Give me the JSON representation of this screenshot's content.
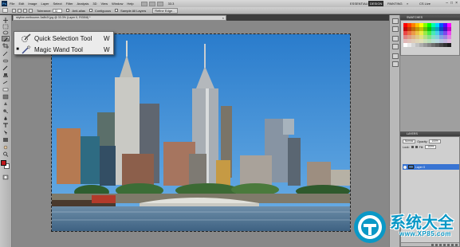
{
  "menubar": {
    "logo": "Ps",
    "items": [
      "File",
      "Edit",
      "Image",
      "Layer",
      "Select",
      "Filter",
      "Analysis",
      "3D",
      "View",
      "Window",
      "Help"
    ],
    "zoom": "33.3",
    "workspaces": {
      "essentials": "ESSENTIALS",
      "design": "DESIGN",
      "painting": "PAINTING",
      "more": "»",
      "cs_live": "CS Live"
    },
    "window_controls": [
      "–",
      "□",
      "×"
    ]
  },
  "options": {
    "tolerance_label": "Tolerance:",
    "tolerance_value": "32",
    "anti_alias_label": "Anti-alias",
    "contiguous_label": "Contiguous",
    "sample_all_label": "Sample All Layers",
    "refine_edge_label": "Refine Edge..."
  },
  "document": {
    "tab_title": "skyline-melbourne-3a8b2f.jpg @ 33.3% (Layer 0, RGB/8) *",
    "close_glyph": "×"
  },
  "flyout": {
    "items": [
      {
        "bullet": "",
        "label": "Quick Selection Tool",
        "shortcut": "W"
      },
      {
        "bullet": "■",
        "label": "Magic Wand Tool",
        "shortcut": "W"
      }
    ]
  },
  "panels": {
    "swatches_tab": "SWATCHES",
    "layers_tab": "LAYERS",
    "blend_mode": "Normal",
    "opacity_label": "Opacity:",
    "opacity_value": "100%",
    "lock_label": "Lock:",
    "fill_label": "Fill:",
    "fill_value": "100%",
    "layer_name": "Layer 0"
  },
  "colors": {
    "foreground": "#c0161b",
    "background": "#ffffff",
    "sky": "#3a86cf",
    "accent_selected": "#3874d3"
  },
  "watermark": {
    "title": "系统大全",
    "url": "www.XP85.com"
  }
}
